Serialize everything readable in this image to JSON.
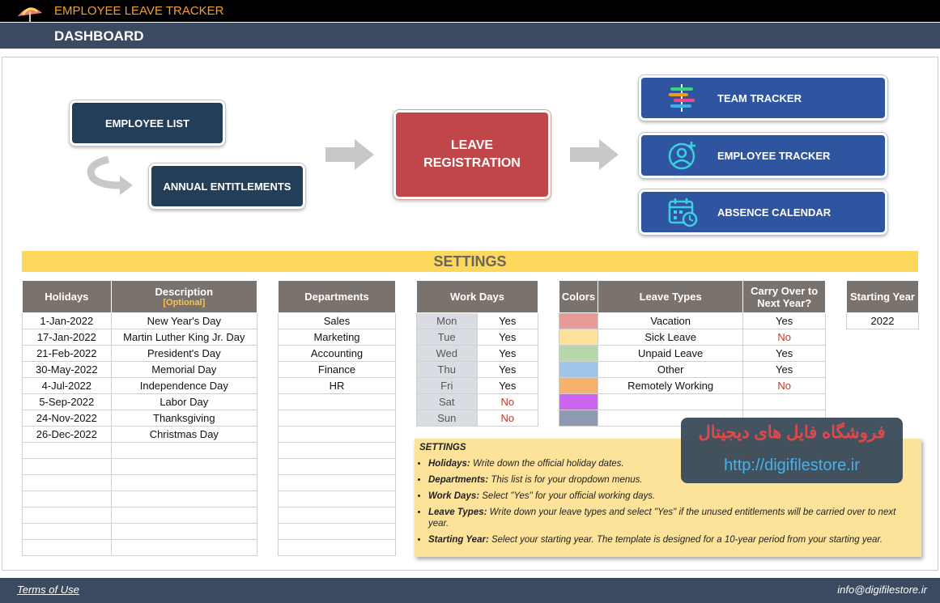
{
  "app": {
    "title": "EMPLOYEE LEAVE TRACKER",
    "page_title": "DASHBOARD"
  },
  "nav": {
    "employee_list": "EMPLOYEE LIST",
    "annual_entitlements": "ANNUAL ENTITLEMENTS",
    "leave_registration_1": "LEAVE",
    "leave_registration_2": "REGISTRATION",
    "team_tracker": "TEAM TRACKER",
    "employee_tracker": "EMPLOYEE TRACKER",
    "absence_calendar": "ABSENCE CALENDAR"
  },
  "settings": {
    "title": "SETTINGS"
  },
  "holidays": {
    "col_holidays": "Holidays",
    "col_description": "Description",
    "col_optional": "[Optional]",
    "rows": [
      {
        "date": "1-Jan-2022",
        "desc": "New Year's Day"
      },
      {
        "date": "17-Jan-2022",
        "desc": "Martin Luther King Jr. Day"
      },
      {
        "date": "21-Feb-2022",
        "desc": "President's Day"
      },
      {
        "date": "30-May-2022",
        "desc": "Memorial Day"
      },
      {
        "date": "4-Jul-2022",
        "desc": "Independence Day"
      },
      {
        "date": "5-Sep-2022",
        "desc": "Labor Day"
      },
      {
        "date": "24-Nov-2022",
        "desc": "Thanksgiving"
      },
      {
        "date": "26-Dec-2022",
        "desc": "Christmas Day"
      }
    ]
  },
  "departments": {
    "col": "Departments",
    "rows": [
      "Sales",
      "Marketing",
      "Accounting",
      "Finance",
      "HR"
    ]
  },
  "work_days": {
    "col": "Work Days",
    "rows": [
      {
        "day": "Mon",
        "value": "Yes"
      },
      {
        "day": "Tue",
        "value": "Yes"
      },
      {
        "day": "Wed",
        "value": "Yes"
      },
      {
        "day": "Thu",
        "value": "Yes"
      },
      {
        "day": "Fri",
        "value": "Yes"
      },
      {
        "day": "Sat",
        "value": "No"
      },
      {
        "day": "Sun",
        "value": "No"
      }
    ]
  },
  "leave_types": {
    "col_colors": "Colors",
    "col_types": "Leave Types",
    "col_carry_1": "Carry Over to",
    "col_carry_2": "Next Year?",
    "rows": [
      {
        "color": "#e89a98",
        "type": "Vacation",
        "carry": "Yes"
      },
      {
        "color": "#fde39a",
        "type": "Sick Leave",
        "carry": "No"
      },
      {
        "color": "#b7d7a8",
        "type": "Unpaid Leave",
        "carry": "Yes"
      },
      {
        "color": "#9fc5e8",
        "type": "Other",
        "carry": "Yes"
      },
      {
        "color": "#f6b26b",
        "type": "Remotely Working",
        "carry": "No"
      },
      {
        "color": "#cc66ee",
        "type": "",
        "carry": ""
      },
      {
        "color": "#8e9ab0",
        "type": "",
        "carry": ""
      }
    ]
  },
  "starting_year": {
    "col": "Starting Year",
    "value": "2022"
  },
  "notes": {
    "title": "SETTINGS",
    "items": [
      {
        "label": "Holidays:",
        "text": " Write down the official holiday dates."
      },
      {
        "label": "Departments:",
        "text": " This list is for your dropdown menus."
      },
      {
        "label": "Work Days:",
        "text": " Select \"Yes\" for your official working days."
      },
      {
        "label": "Leave Types:",
        "text": " Write down your leave types and select \"Yes\" if the unused entitlements will be carried over to next year."
      },
      {
        "label": "Starting Year:",
        "text": " Select your starting year. The template is designed for a 10-year period from your starting year."
      }
    ]
  },
  "watermark": {
    "fa": "فروشگاه فایل های دیجیتال",
    "url": "http://digifilestore.ir"
  },
  "footer": {
    "terms": "Terms of Use",
    "email": "info@digifilestore.ir"
  }
}
